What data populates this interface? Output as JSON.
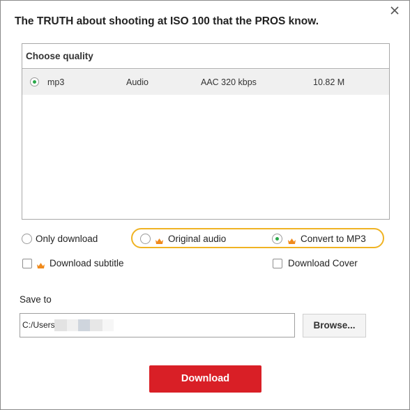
{
  "dialog": {
    "title": "The TRUTH about shooting at ISO 100 that the PROS know.",
    "close_icon": "close-icon"
  },
  "quality": {
    "header": "Choose quality",
    "rows": [
      {
        "selected": true,
        "format": "mp3",
        "type": "Audio",
        "codec": "AAC 320 kbps",
        "size": "10.82 M"
      }
    ]
  },
  "options": {
    "only_download": {
      "label": "Only download",
      "selected": false
    },
    "original_audio": {
      "label": "Original audio",
      "selected": false,
      "premium_icon": "crown-icon"
    },
    "convert_to_mp3": {
      "label": "Convert to MP3",
      "selected": true,
      "premium_icon": "crown-icon"
    },
    "download_subtitle": {
      "label": "Download subtitle",
      "checked": false,
      "premium_icon": "crown-icon"
    },
    "download_cover": {
      "label": "Download Cover",
      "checked": false
    }
  },
  "save_to": {
    "label": "Save to",
    "path": "C:/Users\\"
  },
  "buttons": {
    "browse": "Browse...",
    "download": "Download"
  },
  "colors": {
    "accent_green": "#2aa84a",
    "download_red": "#d91f26",
    "highlight_orange": "#f0b323",
    "crown_orange": "#f08a1c"
  }
}
